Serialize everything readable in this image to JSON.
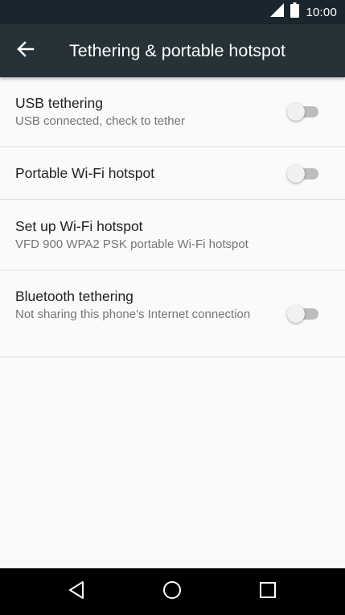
{
  "status_bar": {
    "time": "10:00",
    "icons": [
      "signal-icon",
      "battery-icon"
    ]
  },
  "app_bar": {
    "title": "Tethering & portable hotspot",
    "back_icon": "arrow-back-icon"
  },
  "items": [
    {
      "title": "USB tethering",
      "subtitle": "USB connected, check to tether",
      "toggle": "off"
    },
    {
      "title": "Portable Wi-Fi hotspot",
      "toggle": "off"
    },
    {
      "title": "Set up Wi-Fi hotspot",
      "subtitle": "VFD 900 WPA2 PSK portable Wi-Fi hotspot"
    },
    {
      "title": "Bluetooth tethering",
      "subtitle": "Not sharing this phone's Internet connection",
      "toggle": "off"
    }
  ],
  "nav_bar": {
    "icons": [
      "back-triangle-icon",
      "home-circle-icon",
      "recents-square-icon"
    ]
  },
  "colors": {
    "status_bar": "#1a262d",
    "app_bar": "#263238",
    "background": "#fafafa",
    "title_text": "#212121",
    "subtitle_text": "#757575",
    "divider": "#dcdcdc",
    "toggle_track_off": "#bdbdbd",
    "toggle_thumb_off": "#f1f1f1",
    "nav_bar": "#000000"
  }
}
